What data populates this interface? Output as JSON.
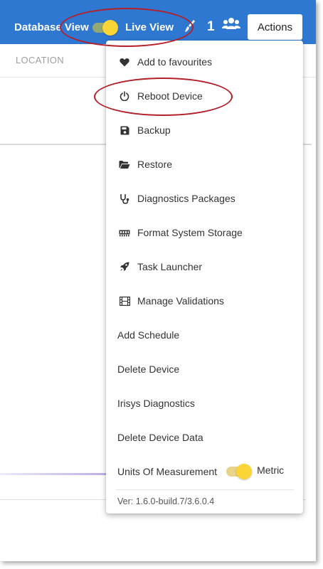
{
  "header": {
    "database_view_label": "Database View",
    "live_view_label": "Live View",
    "user_count": "1",
    "actions_label": "Actions"
  },
  "table": {
    "location_header": "LOCATION"
  },
  "menu": {
    "items": [
      {
        "label": "Add to favourites",
        "icon": "heart-icon"
      },
      {
        "label": "Reboot Device",
        "icon": "power-icon"
      },
      {
        "label": "Backup",
        "icon": "save-icon"
      },
      {
        "label": "Restore",
        "icon": "folder-open-icon"
      },
      {
        "label": "Diagnostics Packages",
        "icon": "stethoscope-icon"
      },
      {
        "label": "Format System Storage",
        "icon": "memory-icon"
      },
      {
        "label": "Task Launcher",
        "icon": "rocket-icon"
      },
      {
        "label": "Manage Validations",
        "icon": "film-icon"
      },
      {
        "label": "Add Schedule"
      },
      {
        "label": "Delete Device"
      },
      {
        "label": "Irisys Diagnostics"
      },
      {
        "label": "Delete Device Data"
      }
    ],
    "units_label": "Units Of Measurement",
    "units_value": "Metric",
    "version": "Ver: 1.6.0-build.7/3.6.0.4"
  },
  "colors": {
    "header_bg": "#2f78d2",
    "toggle_knob": "#fbd536",
    "annotation": "#b3202a"
  }
}
